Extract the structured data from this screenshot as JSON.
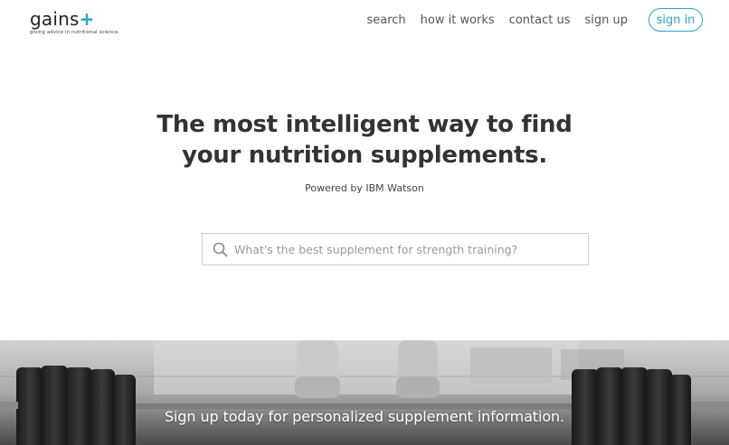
{
  "brand": {
    "name": "gains",
    "plus": "+",
    "tagline": "giving advice in nutritional science."
  },
  "nav": {
    "links": [
      "search",
      "how it works",
      "contact us",
      "sign up"
    ],
    "signin_label": "sign in"
  },
  "hero": {
    "title_line1": "The most intelligent way to find",
    "title_line2": "your nutrition supplements.",
    "powered_by": "Powered by IBM Watson"
  },
  "search": {
    "placeholder": "What's the best supplement for strength training?",
    "value": ""
  },
  "banner": {
    "text": "Sign up today for personalized supplement information."
  },
  "colors": {
    "accent": "#2aa3c8",
    "text": "#333333"
  },
  "icons": {
    "search": "search-icon"
  }
}
